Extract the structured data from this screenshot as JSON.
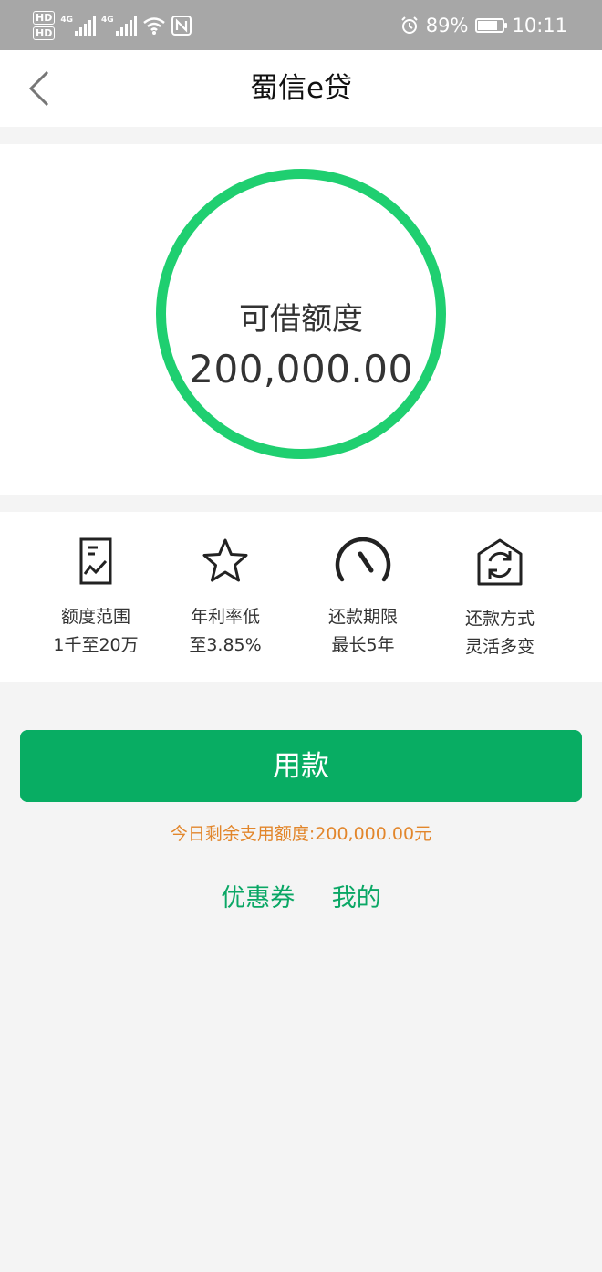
{
  "status_bar": {
    "hd1": "HD",
    "hd2": "HD",
    "net1": "4G",
    "net2": "4G",
    "battery_percent": "89%",
    "battery_level": 0.89,
    "time": "10:11",
    "icons": [
      "hd-icon",
      "signal-icon",
      "wifi-icon",
      "nfc-icon",
      "alarm-icon",
      "battery-icon"
    ]
  },
  "header": {
    "title": "蜀信e贷"
  },
  "quota": {
    "label": "可借额度",
    "amount": "200,000.00"
  },
  "features": [
    {
      "icon": "document-chart-icon",
      "line1": "额度范围",
      "line2": "1千至20万"
    },
    {
      "icon": "star-icon",
      "line1": "年利率低",
      "line2": "至3.85%"
    },
    {
      "icon": "gauge-icon",
      "line1": "还款期限",
      "line2": "最长5年"
    },
    {
      "icon": "refresh-house-icon",
      "line1": "还款方式",
      "line2": "灵活多变"
    }
  ],
  "actions": {
    "use_button": "用款",
    "remaining_text": "今日剩余支用额度:200,000.00元",
    "coupon_link": "优惠券",
    "mine_link": "我的"
  },
  "colors": {
    "accent": "#08ad63",
    "ring": "#1fcf70",
    "remaining_text": "#e2862b",
    "status_bar": "#a7a7a7"
  }
}
